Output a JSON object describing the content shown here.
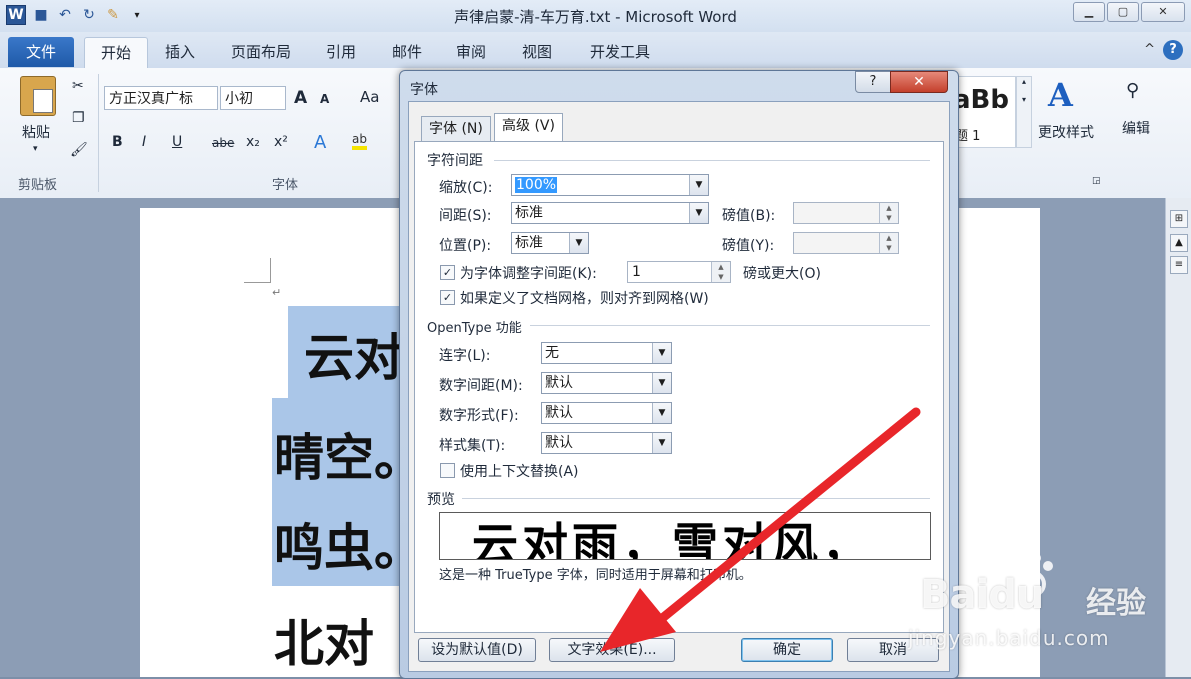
{
  "window": {
    "title": "声律启蒙-清-车万育.txt  -  Microsoft Word",
    "minimize": "▭",
    "maximize": "▢",
    "close": "✕"
  },
  "qat": {
    "logo": "W",
    "save": "💾",
    "undo": "↶",
    "redo": "↻"
  },
  "ribbon_tabs": [
    "文件",
    "开始",
    "插入",
    "页面布局",
    "引用",
    "邮件",
    "审阅",
    "视图",
    "开发工具"
  ],
  "ribbon": {
    "paste": "粘贴",
    "clipboard_group": "剪贴板",
    "font_group": "字体",
    "font_name": "方正汉真广标",
    "font_size": "小初",
    "grow": "A",
    "shrink": "A",
    "aa": "Aa",
    "bold": "B",
    "italic": "I",
    "underline": "U",
    "strike": "abe",
    "sub": "x₂",
    "sup": "x²",
    "style_sample": "aBb",
    "style_name": "题 1",
    "change_styles": "更改样式",
    "editing": "编辑"
  },
  "document": {
    "lines": [
      "云对",
      "晴空。",
      "鸣虫。",
      "北对"
    ]
  },
  "dialog": {
    "title": "字体",
    "help": "?",
    "close": "✕",
    "tabs": [
      "字体 (N)",
      "高级 (V)"
    ],
    "active_tab": "高级 (V)",
    "char_spacing_section": "字符间距",
    "scale_label": "缩放(C):",
    "scale_value": "100%",
    "spacing_label": "间距(S):",
    "spacing_value": "标准",
    "spacing_by_label": "磅值(B):",
    "position_label": "位置(P):",
    "position_value": "标准",
    "position_by_label": "磅值(Y):",
    "kerning_label": "为字体调整字间距(K):",
    "kerning_checked": true,
    "kerning_value": "1",
    "kerning_suffix": "磅或更大(O)",
    "grid_label": "如果定义了文档网格，则对齐到网格(W)",
    "grid_checked": true,
    "opentype_section": "OpenType 功能",
    "ligatures_label": "连字(L):",
    "ligatures_value": "无",
    "num_spacing_label": "数字间距(M):",
    "num_spacing_value": "默认",
    "num_forms_label": "数字形式(F):",
    "num_forms_value": "默认",
    "style_sets_label": "样式集(T):",
    "style_sets_value": "默认",
    "contextual_label": "使用上下文替换(A)",
    "contextual_checked": false,
    "preview_section": "预览",
    "preview_text": "云对雨，雪对风，",
    "preview_note": "这是一种 TrueType 字体，同时适用于屏幕和打印机。",
    "set_default_btn": "设为默认值(D)",
    "text_effects_btn": "文字效果(E)...",
    "ok_btn": "确定",
    "cancel_btn": "取消"
  },
  "watermark": {
    "brand": "Baidu",
    "sub": "经验",
    "url": "jingyan.baidu.com"
  },
  "colors": {
    "accent": "#2b5797",
    "arrow": "#e8262a",
    "selection": "#aac6e8"
  }
}
